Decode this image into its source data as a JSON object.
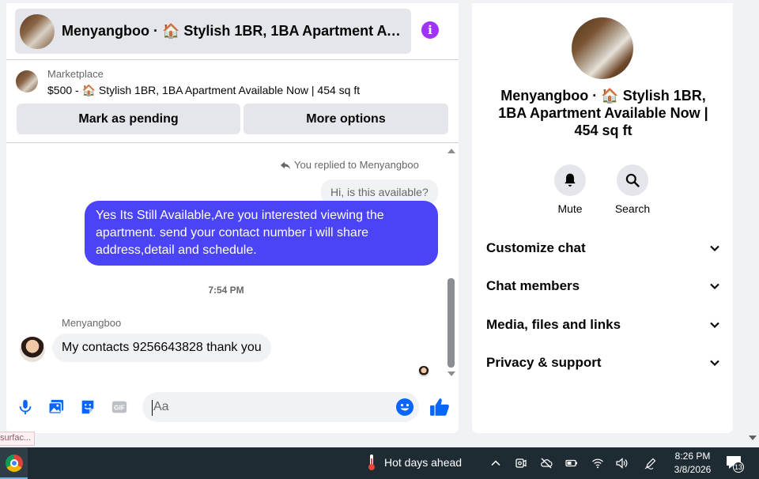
{
  "chat": {
    "header_title": "Menyangboo · 🏠 Stylish 1BR, 1BA Apartment Available Now | 454 sq ft",
    "info_icon": "info-icon",
    "marketplace_label": "Marketplace",
    "listing_line": "$500 - 🏠 Stylish 1BR, 1BA Apartment Available Now | 454 sq ft",
    "mark_pending_label": "Mark as pending",
    "more_options_label": "More options",
    "replied_label": "You replied to Menyangboo",
    "quoted_message": "Hi, is this available?",
    "sent_message": "Yes Its Still Available,Are you interested viewing the apartment. send your contact number i will share address,detail and schedule.",
    "timestamp": "7:54 PM",
    "sender_name": "Menyangboo",
    "received_message": "My contacts 9256643828 thank you",
    "composer_placeholder": "Aa",
    "composer_value": "",
    "accent_color": "#4b44f6"
  },
  "details": {
    "title": "Menyangboo · 🏠 Stylish 1BR, 1BA Apartment Available Now | 454 sq ft",
    "actions": [
      {
        "label": "Mute",
        "icon": "bell-icon"
      },
      {
        "label": "Search",
        "icon": "search-icon"
      }
    ],
    "rows": [
      {
        "label": "Customize chat"
      },
      {
        "label": "Chat members"
      },
      {
        "label": "Media, files and links"
      },
      {
        "label": "Privacy & support"
      }
    ]
  },
  "tooltip": "surfac...",
  "taskbar": {
    "weather": "Hot days ahead",
    "time": "8:26 PM",
    "date": "3/8/2026",
    "notifications": "13"
  }
}
